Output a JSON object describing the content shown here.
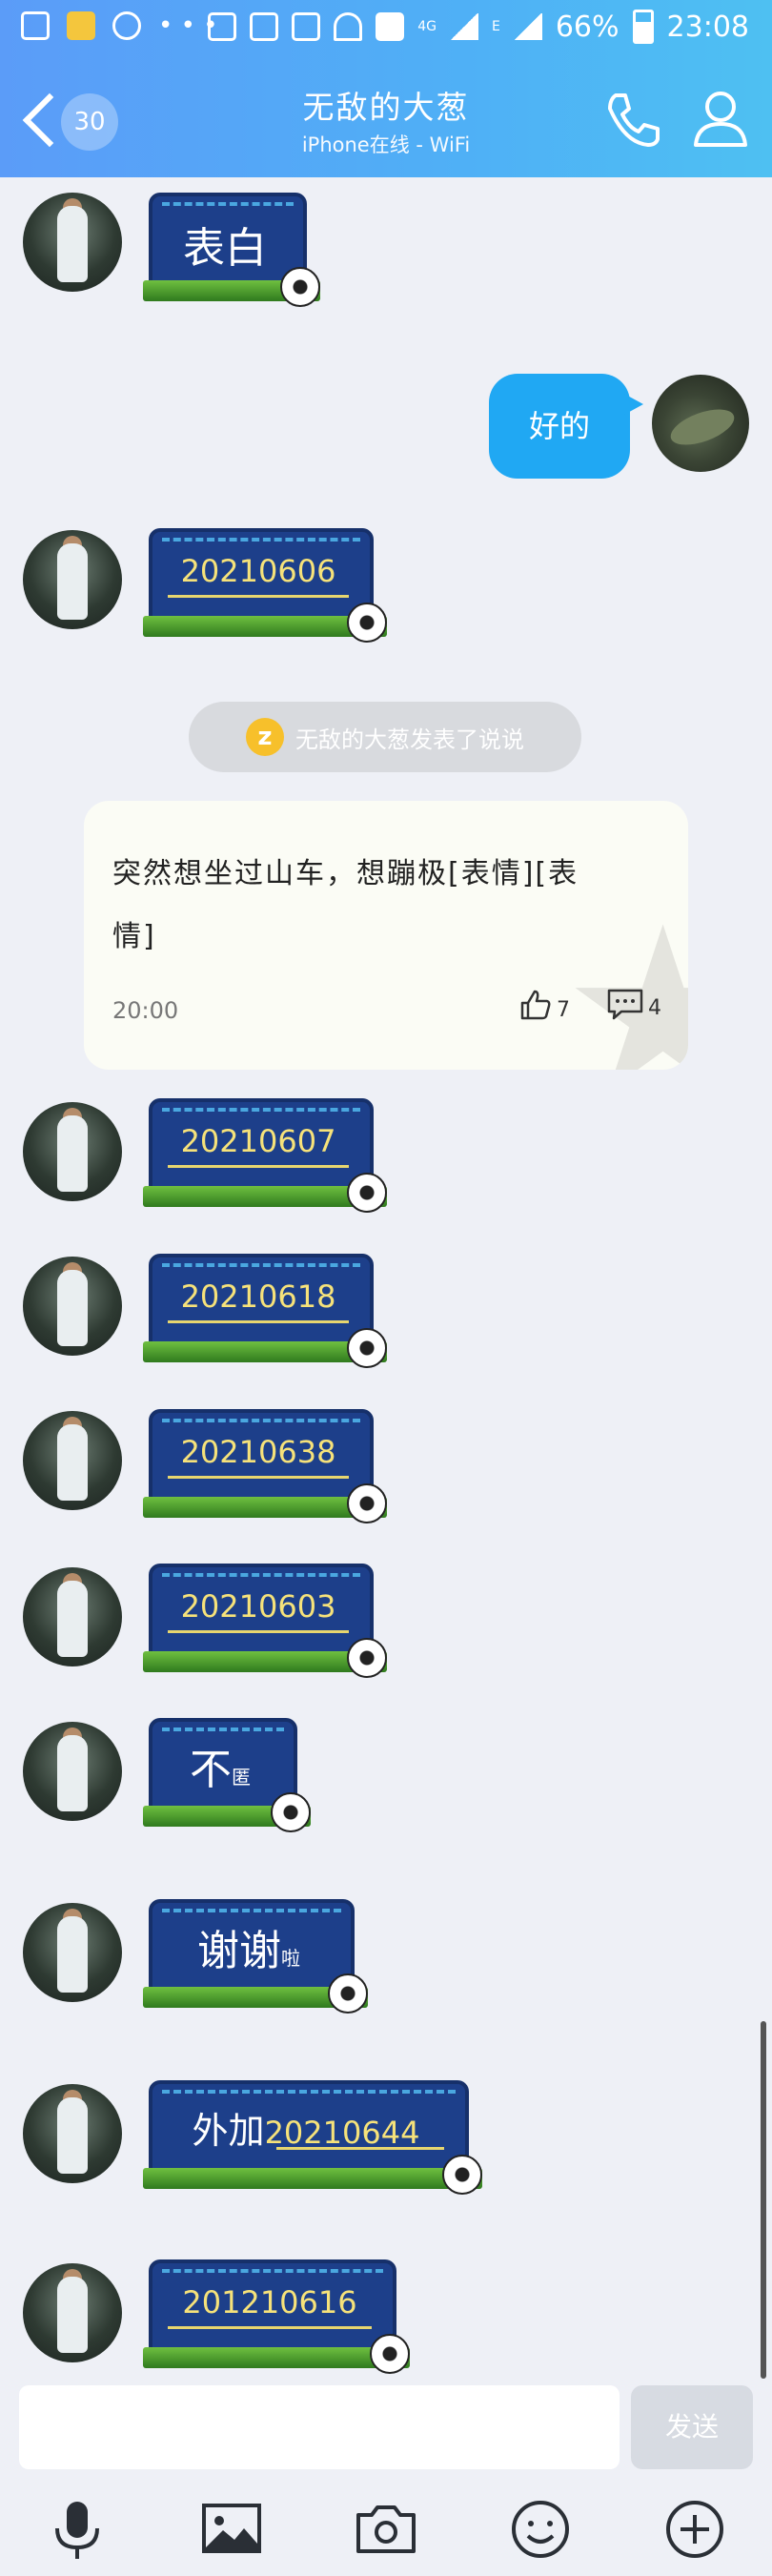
{
  "status_bar": {
    "battery": "66%",
    "time": "23:08",
    "network_4g": "4G",
    "network_e": "E"
  },
  "header": {
    "back_badge": "30",
    "title": "无敌的大葱",
    "subtitle": "iPhone在线 - WiFi"
  },
  "messages": {
    "s1": {
      "text": "表白"
    },
    "me1": {
      "text": "好的"
    },
    "s2": {
      "text": "20210606"
    },
    "system": {
      "text": "无敌的大葱发表了说说"
    },
    "card": {
      "text": "突然想坐过山车，想蹦极[表情][表情]",
      "time": "20:00",
      "likes": "7",
      "comments": "4"
    },
    "s3": {
      "text": "20210607"
    },
    "s4": {
      "text": "20210618"
    },
    "s5": {
      "text": "20210638"
    },
    "s6": {
      "text": "20210603"
    },
    "s7": {
      "text": "不",
      "small": "匿"
    },
    "s8": {
      "text": "谢谢",
      "small": "啦"
    },
    "s9": {
      "prefix": "外加",
      "text": "20210644"
    },
    "s10": {
      "text": "201210616"
    }
  },
  "input": {
    "send_label": "发送",
    "placeholder": ""
  },
  "toolbar": {
    "icons": [
      "mic-icon",
      "image-icon",
      "camera-icon",
      "emoji-icon",
      "plus-icon"
    ]
  },
  "colors": {
    "header_start": "#5b9cf8",
    "header_end": "#4ec0f2",
    "my_bubble": "#20a8f3",
    "background": "#eef0f6"
  }
}
